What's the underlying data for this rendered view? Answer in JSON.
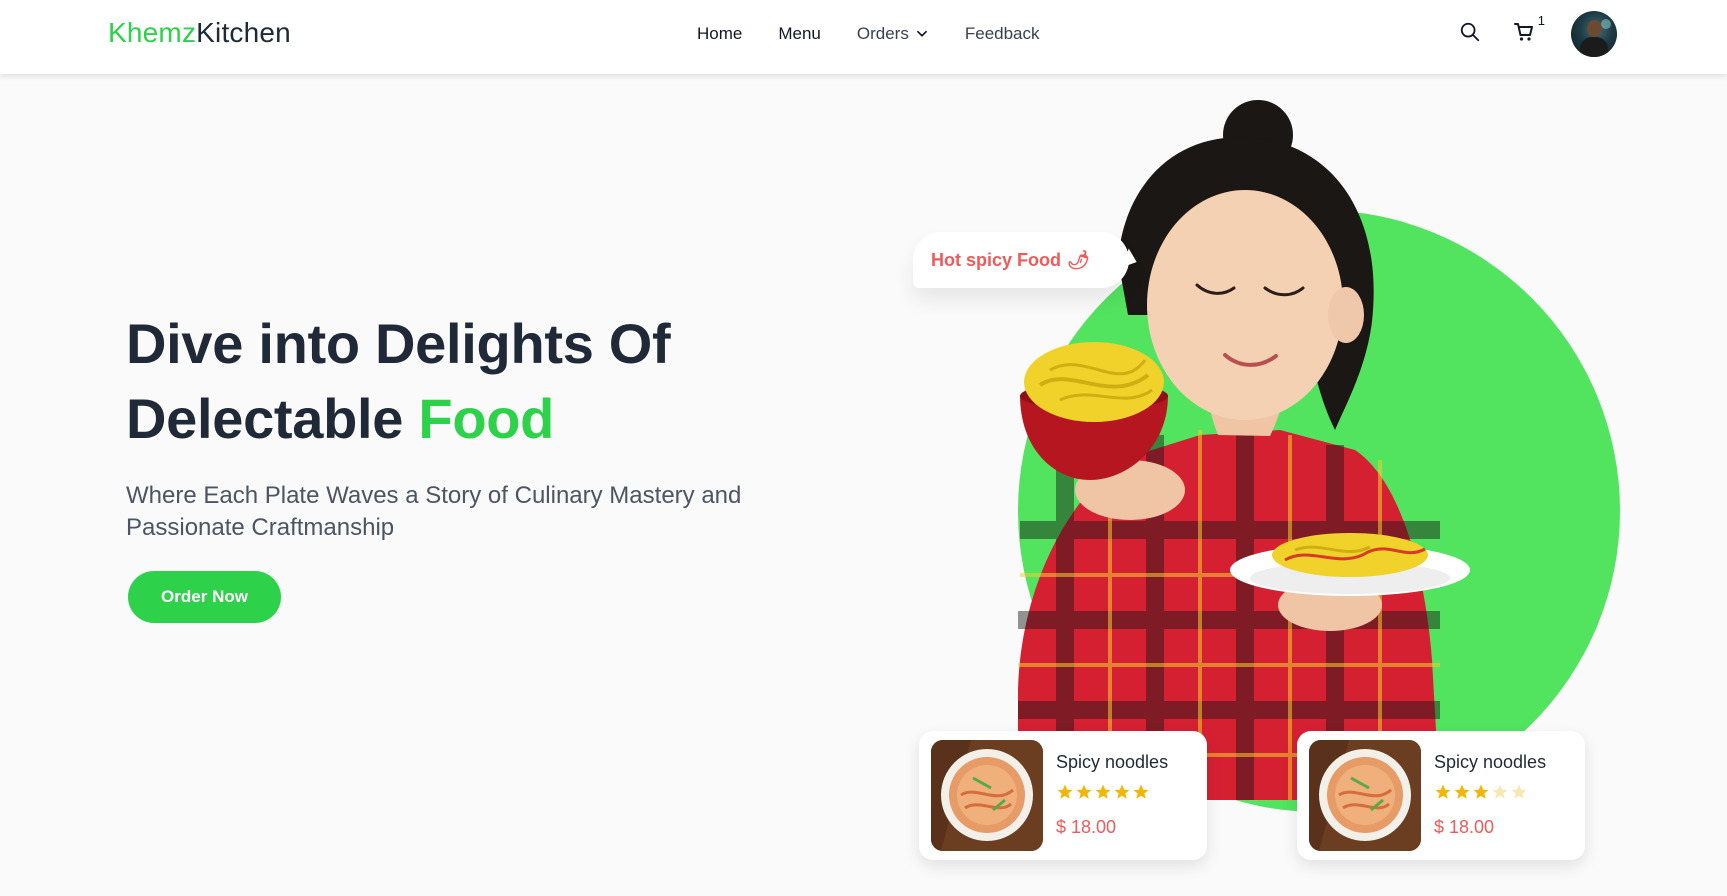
{
  "header": {
    "logo_part1": "Khemz",
    "logo_part2": "Kitchen",
    "nav": [
      "Home",
      "Menu",
      "Orders",
      "Feedback"
    ],
    "cart_count": "1",
    "icons": [
      "search-icon",
      "cart-icon",
      "chevron-down-icon",
      "avatar"
    ]
  },
  "hero": {
    "title_line1": "Dive into Delights Of",
    "title_line2_prefix": "Delectable ",
    "title_accent": "Food",
    "subtitle": "Where Each Plate Waves a Story of Culinary Mastery and Passionate Craftmanship",
    "cta": "Order Now"
  },
  "badge": {
    "text": "Hot spicy Food",
    "emoji": "🌶"
  },
  "cards": [
    {
      "title": "Spicy noodles",
      "price": "$ 18.00",
      "rating": 5
    },
    {
      "title": "Spicy noodles",
      "price": "$ 18.00",
      "rating": 3
    }
  ],
  "colors": {
    "accent": "#2ed14a",
    "circle": "#52e35f",
    "price": "#ef5a5a",
    "star_filled": "#f2b705",
    "star_empty": "#f8e6b3"
  }
}
